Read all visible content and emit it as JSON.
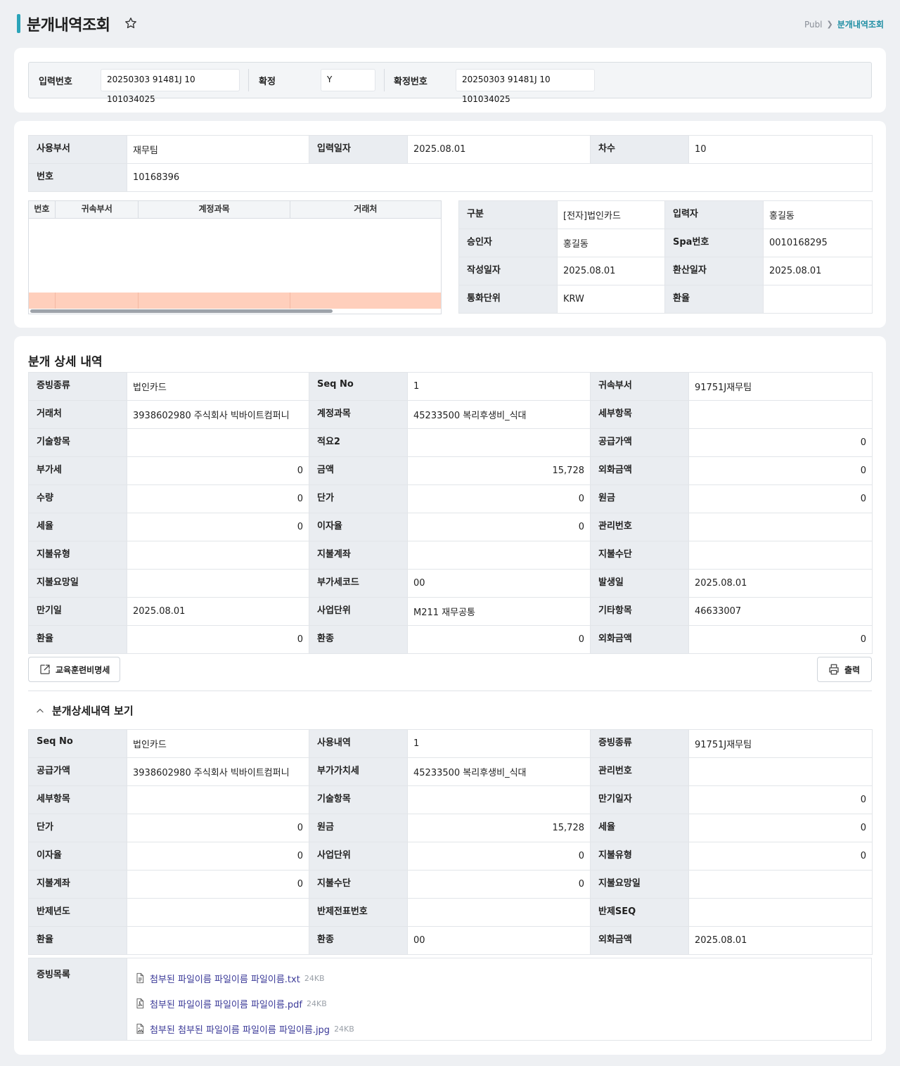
{
  "header": {
    "title": "분개내역조회",
    "breadcrumb": [
      "Publ",
      "분개내역조회"
    ]
  },
  "key_bar": {
    "input_no_label": "입력번호",
    "input_no_value": "20250303 91481J 10 101034025",
    "confirm_label": "확정",
    "confirm_value": "Y",
    "confirm_no_label": "확정번호",
    "confirm_no_value": "20250303 91481J 10 101034025"
  },
  "info": {
    "rows": [
      [
        {
          "label": "사용부서",
          "value": "재무팀"
        },
        {
          "label": "입력일자",
          "value": "2025.08.01"
        },
        {
          "label": "차수",
          "value": "10"
        }
      ],
      [
        {
          "label": "번호",
          "value": "10168396"
        }
      ]
    ]
  },
  "mini_grid": {
    "columns": [
      "번호",
      "귀속부서",
      "계정과목",
      "거래처"
    ]
  },
  "side_info": {
    "rows": [
      [
        {
          "label": "구분",
          "value": "[전자]법인카드"
        },
        {
          "label": "입력자",
          "value": "홍길동"
        }
      ],
      [
        {
          "label": "승인자",
          "value": "홍길동"
        },
        {
          "label": "Spa번호",
          "value": "0010168295"
        }
      ],
      [
        {
          "label": "작성일자",
          "value": "2025.08.01"
        },
        {
          "label": "환산일자",
          "value": "2025.08.01"
        }
      ],
      [
        {
          "label": "통화단위",
          "value": "KRW"
        },
        {
          "label": "환율",
          "value": ""
        }
      ]
    ]
  },
  "detail": {
    "title": "분개 상세 내역",
    "rows": [
      [
        {
          "label": "증빙종류",
          "value": "법인카드"
        },
        {
          "label": "Seq No",
          "value": "1"
        },
        {
          "label": "귀속부서",
          "value": "91751J재무팀"
        }
      ],
      [
        {
          "label": "거래처",
          "value": "3938602980 주식회사 빅바이트컴퍼니"
        },
        {
          "label": "계정과목",
          "value": "45233500 복리후생비_식대"
        },
        {
          "label": "세부항목",
          "value": ""
        }
      ],
      [
        {
          "label": "기술항목",
          "value": ""
        },
        {
          "label": "적요2",
          "value": ""
        },
        {
          "label": "공급가액",
          "value": "0",
          "num": true
        }
      ],
      [
        {
          "label": "부가세",
          "value": "0",
          "num": true
        },
        {
          "label": "금액",
          "value": "15,728",
          "num": true
        },
        {
          "label": "외화금액",
          "value": "0",
          "num": true
        }
      ],
      [
        {
          "label": "수량",
          "value": "0",
          "num": true
        },
        {
          "label": "단가",
          "value": "0",
          "num": true
        },
        {
          "label": "원금",
          "value": "0",
          "num": true
        }
      ],
      [
        {
          "label": "세율",
          "value": "0",
          "num": true
        },
        {
          "label": "이자율",
          "value": "0",
          "num": true
        },
        {
          "label": "관리번호",
          "value": ""
        }
      ],
      [
        {
          "label": "지불유형",
          "value": ""
        },
        {
          "label": "지불계좌",
          "value": ""
        },
        {
          "label": "지불수단",
          "value": ""
        }
      ],
      [
        {
          "label": "지불요망일",
          "value": ""
        },
        {
          "label": "부가세코드",
          "value": "00"
        },
        {
          "label": "발생일",
          "value": "2025.08.01"
        }
      ],
      [
        {
          "label": "만기일",
          "value": "2025.08.01"
        },
        {
          "label": "사업단위",
          "value": "M211 재무공통"
        },
        {
          "label": "기타항목",
          "value": "46633007"
        }
      ],
      [
        {
          "label": "환율",
          "value": "0",
          "num": true
        },
        {
          "label": "환종",
          "value": "0",
          "num": true
        },
        {
          "label": "외화금액",
          "value": "0",
          "num": true
        }
      ]
    ],
    "edu_button": "교육훈련비명세",
    "print_button": "출력"
  },
  "sub_detail": {
    "title": "분개상세내역 보기",
    "rows": [
      [
        {
          "label": "Seq No",
          "value": "법인카드"
        },
        {
          "label": "사용내역",
          "value": "1"
        },
        {
          "label": "증빙종류",
          "value": "91751J재무팀"
        }
      ],
      [
        {
          "label": "공급가액",
          "value": "3938602980 주식회사 빅바이트컴퍼니"
        },
        {
          "label": "부가가치세",
          "value": "45233500 복리후생비_식대"
        },
        {
          "label": "관리번호",
          "value": ""
        }
      ],
      [
        {
          "label": "세부항목",
          "value": ""
        },
        {
          "label": "기술항목",
          "value": ""
        },
        {
          "label": "만기일자",
          "value": "0",
          "num": true
        }
      ],
      [
        {
          "label": "단가",
          "value": "0",
          "num": true
        },
        {
          "label": "원금",
          "value": "15,728",
          "num": true
        },
        {
          "label": "세율",
          "value": "0",
          "num": true
        }
      ],
      [
        {
          "label": "이자율",
          "value": "0",
          "num": true
        },
        {
          "label": "사업단위",
          "value": "0",
          "num": true
        },
        {
          "label": "지불유형",
          "value": "0",
          "num": true
        }
      ],
      [
        {
          "label": "지불계좌",
          "value": "0",
          "num": true
        },
        {
          "label": "지불수단",
          "value": "0",
          "num": true
        },
        {
          "label": "지불요망일",
          "value": ""
        }
      ],
      [
        {
          "label": "반제년도",
          "value": ""
        },
        {
          "label": "반제전표번호",
          "value": ""
        },
        {
          "label": "반제SEQ",
          "value": ""
        }
      ],
      [
        {
          "label": "환율",
          "value": ""
        },
        {
          "label": "환종",
          "value": "00"
        },
        {
          "label": "외화금액",
          "value": "2025.08.01"
        }
      ]
    ],
    "attachments_label": "증빙목록",
    "attachments": [
      {
        "name": "첨부된 파일이름 파일이름 파일이름.txt",
        "size": "24KB",
        "icon": "file-text-icon"
      },
      {
        "name": "첨부된 파일이름 파일이름 파일이름.pdf",
        "size": "24KB",
        "icon": "file-pdf-icon"
      },
      {
        "name": "첨부된 첨부된 파일이름 파일이름 파일이름.jpg",
        "size": "24KB",
        "icon": "file-image-icon"
      }
    ]
  }
}
